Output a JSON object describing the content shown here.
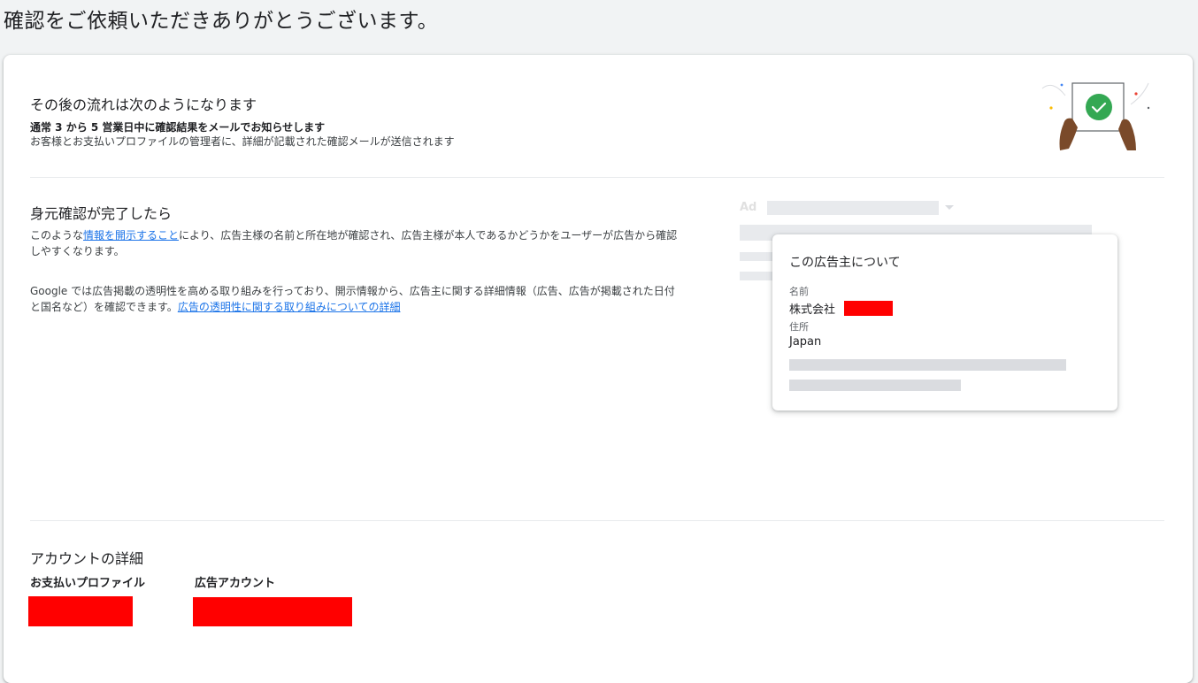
{
  "page": {
    "title": "確認をご依頼いただきありがとうございます。"
  },
  "next_steps": {
    "heading": "その後の流れは次のようになります",
    "bold_line": "通常 3 から 5 営業日中に確認結果をメールでお知らせします",
    "body": "お客様とお支払いプロファイルの管理者に、詳細が記載された確認メールが送信されます"
  },
  "after_verification": {
    "heading": "身元確認が完了したら",
    "para1_prefix": "このような",
    "para1_link": "情報を開示すること",
    "para1_suffix": "により、広告主様の名前と所在地が確認され、広告主様が本人であるかどうかをユーザーが広告から確認しやすくなります。",
    "para2_text": "Google では広告掲載の透明性を高める取り組みを行っており、開示情報から、広告主に関する詳細情報（広告、広告が掲載された日付と国名など）を確認できます。",
    "para2_link": "広告の透明性に関する取り組みについての詳細"
  },
  "ad_preview": {
    "ad_label": "Ad",
    "advertiser_card": {
      "title": "この広告主について",
      "name_label": "名前",
      "name_value": "株式会社",
      "address_label": "住所",
      "address_value": "Japan"
    }
  },
  "account_details": {
    "heading": "アカウントの詳細",
    "payment_profile_label": "お支払いプロファイル",
    "ad_account_label": "広告アカウント"
  },
  "colors": {
    "link": "#1a73e8",
    "check_green": "#34a853",
    "redaction": "#ff0000"
  }
}
